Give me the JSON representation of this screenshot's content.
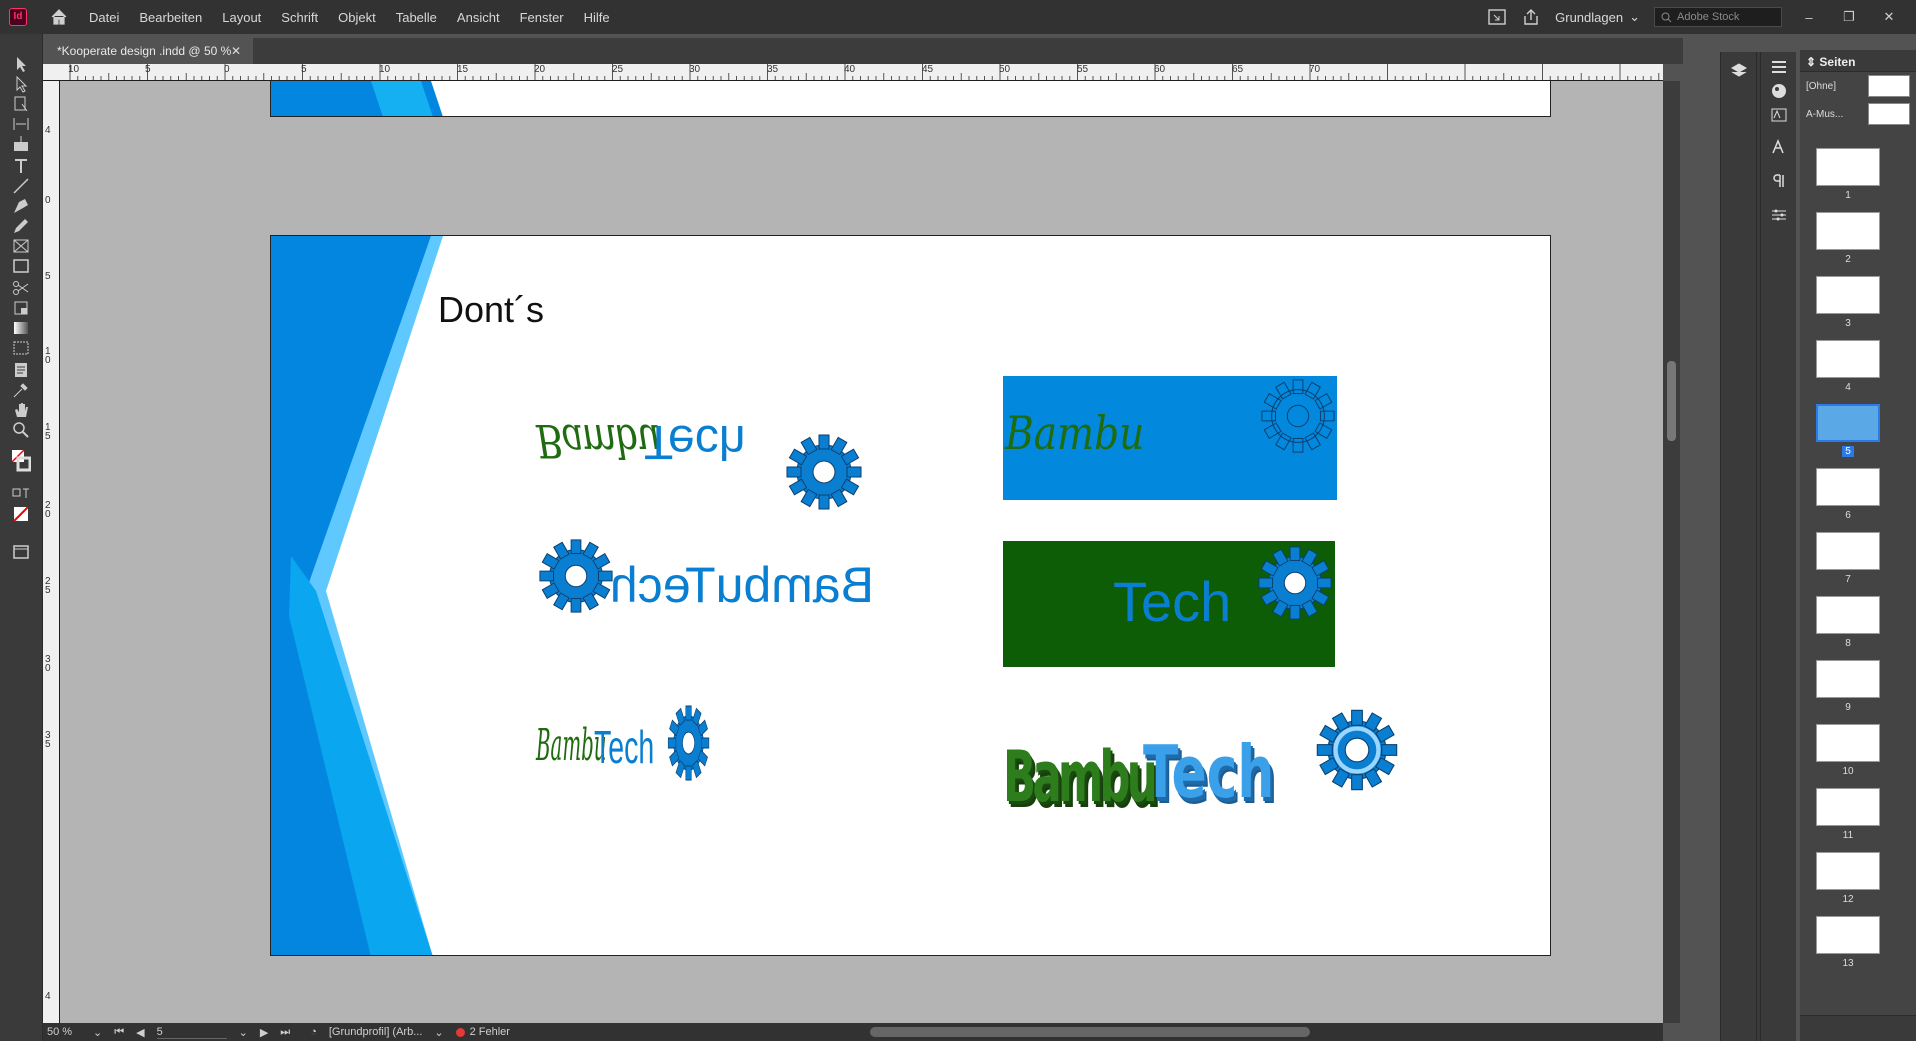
{
  "app": {
    "logo": "Id",
    "menu": [
      "Datei",
      "Bearbeiten",
      "Layout",
      "Schrift",
      "Objekt",
      "Tabelle",
      "Ansicht",
      "Fenster",
      "Hilfe"
    ],
    "workspace": "Grundlagen",
    "stock_placeholder": "Adobe Stock",
    "win_min": "–",
    "win_max": "❐",
    "win_close": "✕"
  },
  "document": {
    "tab_title": "*Kooperate design .indd @ 50 %",
    "close": "✕"
  },
  "ruler": {
    "h_labels": [
      "10",
      "5",
      "0",
      "5",
      "10",
      "15",
      "20",
      "25",
      "30",
      "35",
      "40",
      "45",
      "50",
      "55",
      "60",
      "65",
      "70"
    ],
    "v_labels": [
      "4",
      "0",
      "5",
      "1 0",
      "1 5",
      "2 0",
      "2 5",
      "3 0",
      "3 5",
      "4"
    ]
  },
  "slide": {
    "heading": "Dont´s",
    "logo_word1": "Bambu",
    "logo_word2": "Tech",
    "logo_full": "BambuTech",
    "mirrored_text": "BambuTech",
    "colors": {
      "blue": "#0a7fd1",
      "green": "#1f6b10",
      "box_blue": "#0288dd",
      "box_green": "#0d5d06"
    }
  },
  "status": {
    "zoom": "50 %",
    "page": "5",
    "profile": "[Grundprofil] (Arb...",
    "errors": "2 Fehler"
  },
  "pages_panel": {
    "title": "Seiten",
    "master_none": "[Ohne]",
    "master_a": "A-Mus...",
    "pages": [
      "1",
      "2",
      "3",
      "4",
      "5",
      "6",
      "7",
      "8",
      "9",
      "10",
      "11",
      "12",
      "13"
    ],
    "selected": "5"
  }
}
